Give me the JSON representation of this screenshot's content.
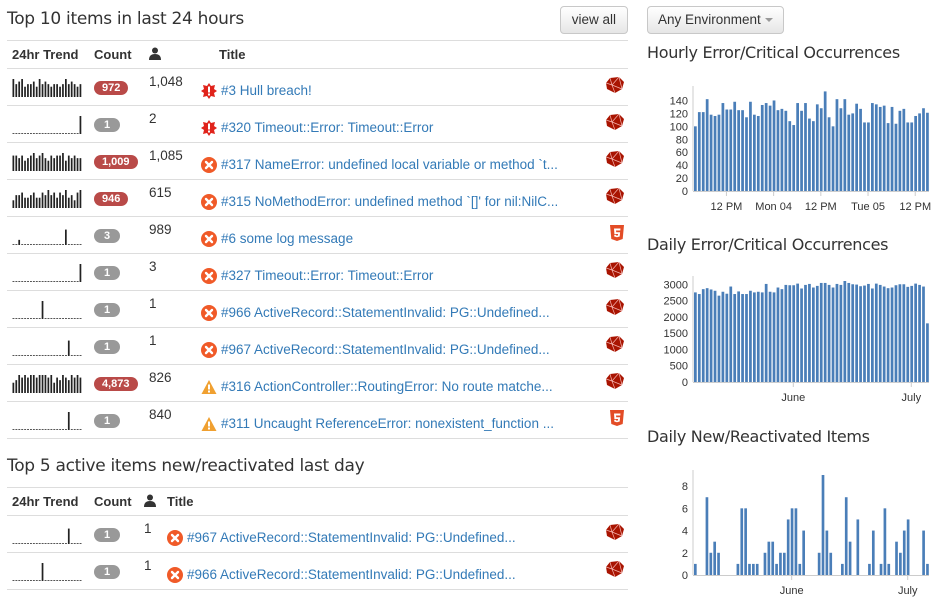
{
  "top10": {
    "title": "Top 10 items in last 24 hours",
    "view_all_label": "view all",
    "columns": {
      "trend": "24hr Trend",
      "count": "Count",
      "users_icon": "user-icon",
      "title": "Title"
    },
    "rows": [
      {
        "trend": [
          7,
          5,
          6,
          7,
          4,
          5,
          5,
          6,
          4,
          7,
          5,
          6,
          5,
          4,
          5,
          5,
          4,
          5,
          7,
          5,
          6,
          5,
          4,
          5
        ],
        "count": "972",
        "count_style": "red",
        "users": "1,048",
        "level": "critical",
        "title": "#3 Hull breach!",
        "platform": "ruby"
      },
      {
        "trend": [
          0,
          0,
          0,
          0,
          0,
          0,
          0,
          0,
          0,
          0,
          0,
          0,
          0,
          0,
          0,
          0,
          0,
          0,
          0,
          0,
          0,
          0,
          0,
          7
        ],
        "count": "1",
        "count_style": "gray",
        "users": "2",
        "level": "critical",
        "title": "#320 Timeout::Error: Timeout::Error",
        "platform": "ruby"
      },
      {
        "trend": [
          6,
          6,
          5,
          6,
          4,
          5,
          6,
          7,
          5,
          6,
          7,
          5,
          4,
          6,
          5,
          6,
          6,
          7,
          4,
          6,
          5,
          6,
          5,
          5
        ],
        "count": "1,009",
        "count_style": "red",
        "users": "1,085",
        "level": "error",
        "title": "#317 NameError: undefined local variable or method `t...",
        "platform": "ruby"
      },
      {
        "trend": [
          3,
          5,
          5,
          6,
          4,
          4,
          5,
          6,
          4,
          4,
          6,
          5,
          7,
          5,
          6,
          4,
          6,
          5,
          7,
          4,
          5,
          3,
          6,
          7
        ],
        "count": "946",
        "count_style": "red",
        "users": "615",
        "level": "error",
        "title": "#315 NoMethodError: undefined method `[]' for nil:NilC...",
        "platform": "ruby"
      },
      {
        "trend": [
          0,
          0,
          2,
          0,
          0,
          0,
          0,
          0,
          0,
          0,
          0,
          0,
          0,
          0,
          0,
          0,
          0,
          0,
          6,
          0,
          0,
          0,
          0,
          0
        ],
        "count": "3",
        "count_style": "gray",
        "users": "989",
        "level": "error",
        "title": "#6 some log message",
        "platform": "html5"
      },
      {
        "trend": [
          0,
          0,
          0,
          0,
          0,
          0,
          0,
          0,
          0,
          0,
          0,
          0,
          0,
          0,
          0,
          0,
          0,
          0,
          0,
          0,
          0,
          0,
          0,
          7
        ],
        "count": "1",
        "count_style": "gray",
        "users": "3",
        "level": "error",
        "title": "#327 Timeout::Error: Timeout::Error",
        "platform": "ruby"
      },
      {
        "trend": [
          0,
          0,
          0,
          0,
          0,
          0,
          0,
          0,
          0,
          0,
          7,
          0,
          0,
          0,
          0,
          0,
          0,
          0,
          0,
          0,
          0,
          0,
          0,
          0
        ],
        "count": "1",
        "count_style": "gray",
        "users": "1",
        "level": "error",
        "title": "#966 ActiveRecord::StatementInvalid: PG::Undefined...",
        "platform": "ruby"
      },
      {
        "trend": [
          0,
          0,
          0,
          0,
          0,
          0,
          0,
          0,
          0,
          0,
          0,
          0,
          0,
          0,
          0,
          0,
          0,
          0,
          0,
          6,
          0,
          0,
          0,
          0
        ],
        "count": "1",
        "count_style": "gray",
        "users": "1",
        "level": "error",
        "title": "#967 ActiveRecord::StatementInvalid: PG::Undefined...",
        "platform": "ruby"
      },
      {
        "trend": [
          4,
          5,
          7,
          6,
          7,
          6,
          7,
          7,
          6,
          7,
          7,
          7,
          6,
          7,
          4,
          6,
          5,
          7,
          6,
          5,
          7,
          6,
          7,
          6
        ],
        "count": "4,873",
        "count_style": "red",
        "users": "826",
        "level": "warning",
        "title": "#316 ActionController::RoutingError: No route matche...",
        "platform": "ruby"
      },
      {
        "trend": [
          0,
          0,
          0,
          0,
          0,
          0,
          0,
          0,
          0,
          0,
          0,
          0,
          0,
          0,
          0,
          0,
          0,
          0,
          0,
          7,
          0,
          0,
          0,
          0
        ],
        "count": "1",
        "count_style": "gray",
        "users": "840",
        "level": "warning",
        "title": "#311 Uncaught ReferenceError: nonexistent_function ...",
        "platform": "html5"
      }
    ]
  },
  "top5": {
    "title": "Top 5 active items new/reactivated last day",
    "columns": {
      "trend": "24hr Trend",
      "count": "Count",
      "users_icon": "user-icon",
      "title": "Title"
    },
    "rows": [
      {
        "trend": [
          0,
          0,
          0,
          0,
          0,
          0,
          0,
          0,
          0,
          0,
          0,
          0,
          0,
          0,
          0,
          0,
          0,
          0,
          0,
          6,
          0,
          0,
          0,
          0
        ],
        "count": "1",
        "count_style": "gray",
        "users": "1",
        "level": "error",
        "title": "#967 ActiveRecord::StatementInvalid: PG::Undefined...",
        "platform": "ruby"
      },
      {
        "trend": [
          0,
          0,
          0,
          0,
          0,
          0,
          0,
          0,
          0,
          0,
          7,
          0,
          0,
          0,
          0,
          0,
          0,
          0,
          0,
          0,
          0,
          0,
          0,
          0
        ],
        "count": "1",
        "count_style": "gray",
        "users": "1",
        "level": "error",
        "title": "#966 ActiveRecord::StatementInvalid: PG::Undefined...",
        "platform": "ruby"
      }
    ]
  },
  "environment_select": {
    "selected": "Any Environment"
  },
  "colors": {
    "bar": "#4a7eb8",
    "badge_red": "#b94a48",
    "badge_gray": "#999999",
    "link": "#337ab7",
    "critical": "#e0231b",
    "error": "#f05a28",
    "warning": "#f0a030"
  },
  "chart_data": [
    {
      "type": "bar",
      "title": "Hourly Error/Critical Occurrences",
      "xlabel": "",
      "ylabel": "",
      "ylim": [
        0,
        150
      ],
      "yticks": [
        0,
        20,
        40,
        60,
        80,
        100,
        120,
        140
      ],
      "xtick_labels": [
        {
          "label": "12 PM",
          "index": 8
        },
        {
          "label": "Mon 04",
          "index": 20
        },
        {
          "label": "12 PM",
          "index": 32
        },
        {
          "label": "Tue 05",
          "index": 44
        },
        {
          "label": "12 PM",
          "index": 56
        }
      ],
      "values": [
        100,
        122,
        122,
        142,
        118,
        116,
        118,
        136,
        126,
        126,
        138,
        125,
        125,
        114,
        138,
        118,
        116,
        133,
        136,
        132,
        140,
        125,
        127,
        124,
        108,
        102,
        136,
        124,
        136,
        112,
        108,
        134,
        128,
        154,
        114,
        100,
        142,
        128,
        142,
        118,
        120,
        135,
        127,
        106,
        106,
        136,
        134,
        130,
        132,
        105,
        130,
        104,
        124,
        127,
        106,
        106,
        116,
        120,
        128,
        121
      ]
    },
    {
      "type": "bar",
      "title": "Daily Error/Critical Occurrences",
      "xlabel": "",
      "ylabel": "",
      "ylim": [
        0,
        3100
      ],
      "yticks": [
        0,
        500,
        1000,
        1500,
        2000,
        2500,
        3000
      ],
      "xtick_labels": [
        {
          "label": "June",
          "index": 25
        },
        {
          "label": "July",
          "index": 55
        }
      ],
      "values": [
        2750,
        2700,
        2850,
        2880,
        2840,
        2800,
        2650,
        2770,
        2710,
        2930,
        2700,
        2780,
        2700,
        2700,
        2800,
        2750,
        2770,
        2750,
        3010,
        2770,
        2750,
        2900,
        2850,
        2980,
        2970,
        2970,
        3020,
        2870,
        2980,
        3010,
        2900,
        2950,
        3040,
        3040,
        2980,
        2900,
        3010,
        2980,
        3100,
        3040,
        3000,
        2990,
        2940,
        2960,
        3010,
        2870,
        3020,
        2980,
        2930,
        2880,
        2900,
        2970,
        3000,
        3000,
        2920,
        2950,
        3020,
        2980,
        2930,
        1800
      ]
    },
    {
      "type": "bar",
      "title": "Daily New/Reactivated Items",
      "xlabel": "",
      "ylabel": "",
      "ylim": [
        0,
        9
      ],
      "yticks": [
        0,
        2,
        4,
        6,
        8
      ],
      "xtick_labels": [
        {
          "label": "June",
          "index": 25
        },
        {
          "label": "July",
          "index": 55
        }
      ],
      "values": [
        1,
        0,
        0,
        7,
        2,
        3,
        2,
        0,
        0,
        0,
        0,
        1,
        6,
        6,
        1,
        1,
        1,
        0,
        2,
        3,
        3,
        1,
        2,
        2,
        5,
        6,
        6,
        1,
        4,
        0,
        0,
        0,
        2,
        9,
        4,
        2,
        0,
        0,
        1,
        7,
        3,
        0,
        5,
        0,
        0,
        1,
        4,
        0,
        1,
        6,
        1,
        0,
        3,
        2,
        4,
        5,
        0,
        0,
        0,
        4,
        1
      ]
    }
  ]
}
